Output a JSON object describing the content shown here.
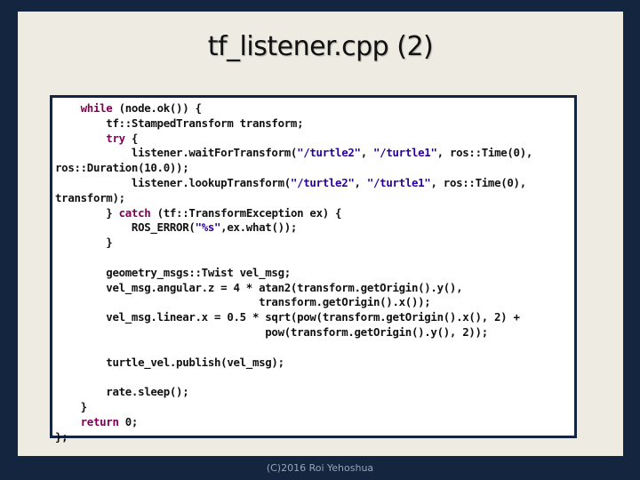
{
  "slide": {
    "title": "tf_listener.cpp (2)",
    "footer": "(C)2016 Roi Yehoshua"
  },
  "code": {
    "language": "cpp",
    "lines": [
      [
        {
          "t": "    "
        },
        {
          "t": "while",
          "c": "kw"
        },
        {
          "t": " (node.ok()) {"
        }
      ],
      [
        {
          "t": "        tf::StampedTransform transform;"
        }
      ],
      [
        {
          "t": "        "
        },
        {
          "t": "try",
          "c": "kw"
        },
        {
          "t": " {"
        }
      ],
      [
        {
          "t": "            listener.waitForTransform("
        },
        {
          "t": "\"/turtle2\"",
          "c": "str"
        },
        {
          "t": ", "
        },
        {
          "t": "\"/turtle1\"",
          "c": "str"
        },
        {
          "t": ", ros::Time(0),"
        }
      ],
      [
        {
          "t": "ros::Duration(10.0));"
        }
      ],
      [
        {
          "t": "            listener.lookupTransform("
        },
        {
          "t": "\"/turtle2\"",
          "c": "str"
        },
        {
          "t": ", "
        },
        {
          "t": "\"/turtle1\"",
          "c": "str"
        },
        {
          "t": ", ros::Time(0),"
        }
      ],
      [
        {
          "t": "transform);"
        }
      ],
      [
        {
          "t": "        } "
        },
        {
          "t": "catch",
          "c": "kw"
        },
        {
          "t": " (tf::TransformException ex) {"
        }
      ],
      [
        {
          "t": "            ROS_ERROR("
        },
        {
          "t": "\"%s\"",
          "c": "str"
        },
        {
          "t": ",ex.what());"
        }
      ],
      [
        {
          "t": "        }"
        }
      ],
      [
        {
          "t": ""
        }
      ],
      [
        {
          "t": "        geometry_msgs::Twist vel_msg;"
        }
      ],
      [
        {
          "t": "        vel_msg.angular.z = 4 * atan2(transform.getOrigin().y(),"
        }
      ],
      [
        {
          "t": "                                transform.getOrigin().x());"
        }
      ],
      [
        {
          "t": "        vel_msg.linear.x = 0.5 * sqrt(pow(transform.getOrigin().x(), 2) +"
        }
      ],
      [
        {
          "t": "                                 pow(transform.getOrigin().y(), 2));"
        }
      ],
      [
        {
          "t": ""
        }
      ],
      [
        {
          "t": "        turtle_vel.publish(vel_msg);"
        }
      ],
      [
        {
          "t": ""
        }
      ],
      [
        {
          "t": "        rate.sleep();"
        }
      ],
      [
        {
          "t": "    }"
        }
      ],
      [
        {
          "t": "    "
        },
        {
          "t": "return",
          "c": "kw"
        },
        {
          "t": " 0;"
        }
      ],
      [
        {
          "t": "};"
        }
      ]
    ]
  },
  "colors": {
    "frame": "#13253f",
    "panel": "#edebe2",
    "keyword": "#7f0055",
    "string": "#2a00a0"
  }
}
